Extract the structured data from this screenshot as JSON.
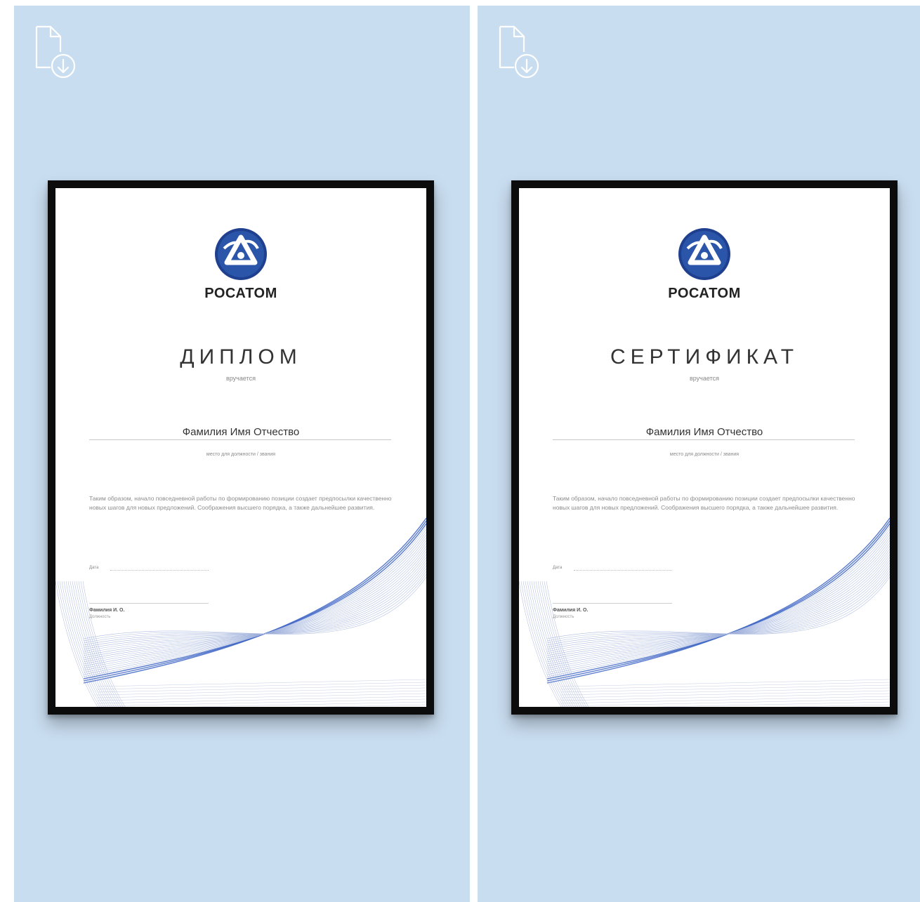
{
  "cards": [
    {
      "action_icon": "file-download-icon",
      "brand": "РОСАТОМ",
      "title": "ДИПЛОМ",
      "subtitle": "вручается",
      "name": "Фамилия Имя Отчество",
      "position": "место для должности / звания",
      "body": "Таким образом, начало повседневной работы по формированию позиции создает предпосылки качественно новых шагов для новых предложений. Соображения высшего порядка, а также дальнейшее развития.",
      "date_label": "Дата",
      "signer": "Фамилия И. О.",
      "signer_role": "Должность"
    },
    {
      "action_icon": "file-download-icon",
      "brand": "РОСАТОМ",
      "title": "СЕРТИФИКАТ",
      "subtitle": "вручается",
      "name": "Фамилия Имя Отчество",
      "position": "место для должности / звания",
      "body": "Таким образом, начало повседневной работы по формированию позиции создает предпосылки качественно новых шагов для новых предложений. Соображения высшего порядка, а также дальнейшее развития.",
      "date_label": "Дата",
      "signer": "Фамилия И. О.",
      "signer_role": "Должность"
    }
  ],
  "colors": {
    "card_background": "#c9ddf0",
    "frame": "#0c0c0c",
    "logo_blue": "#1f3f8f",
    "icon": "#ffffff"
  }
}
